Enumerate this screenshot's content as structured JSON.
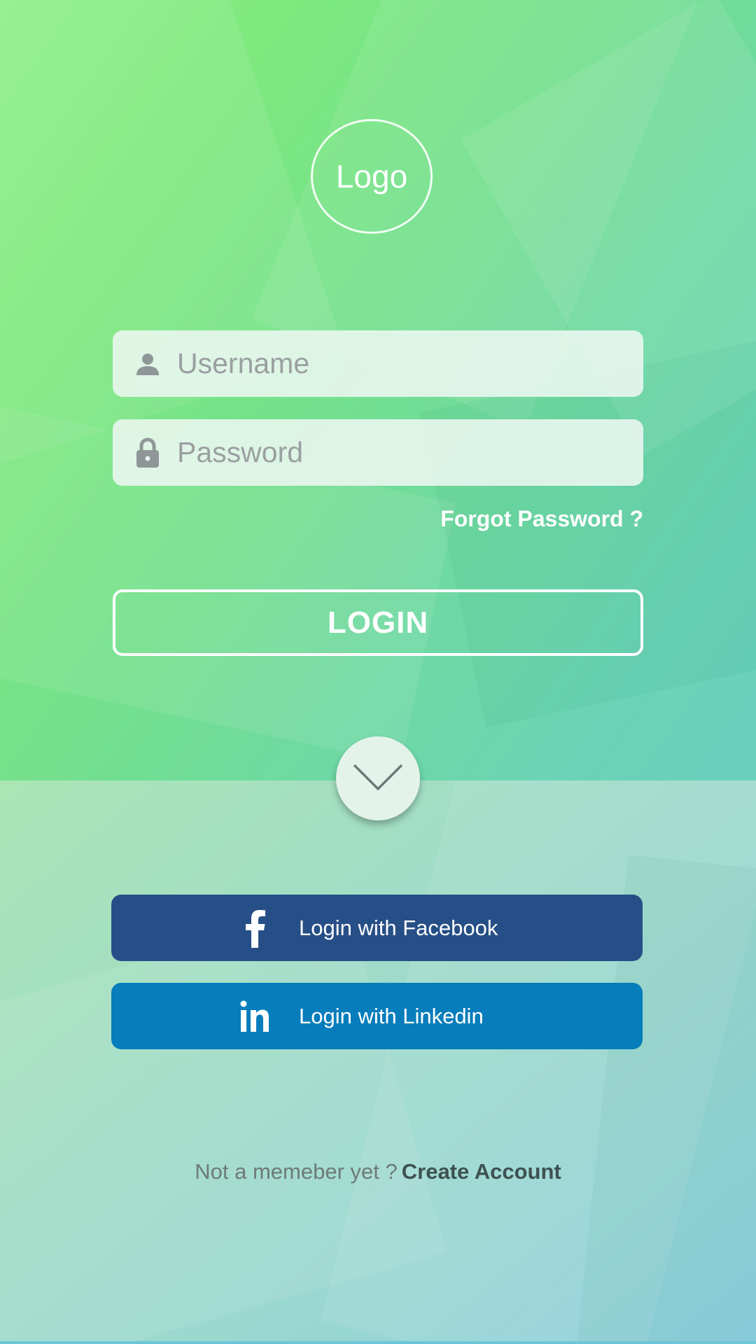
{
  "logo": {
    "text": "Logo"
  },
  "form": {
    "username_placeholder": "Username",
    "password_placeholder": "Password",
    "forgot_label": "Forgot Password ?",
    "login_label": "LOGIN"
  },
  "social": {
    "facebook_label": "Login with Facebook",
    "linkedin_label": "Login with Linkedin",
    "facebook_icon_text": "f",
    "linkedin_icon_text": "in"
  },
  "signup": {
    "prompt": "Not a memeber yet ?",
    "link": "Create Account"
  },
  "icons": {
    "username": "user-icon",
    "password": "lock-icon",
    "toggle": "chevron-down-icon",
    "facebook": "facebook-icon",
    "linkedin": "linkedin-icon"
  },
  "colors": {
    "top_gradient_start": "#8ef08a",
    "top_gradient_end": "#6acfbd",
    "facebook": "#274f87",
    "linkedin": "#077dbb",
    "input_bg": "#ecf7f1",
    "text_white": "#ffffff",
    "placeholder": "#9a9fa0",
    "link_dark": "#3d5250"
  }
}
